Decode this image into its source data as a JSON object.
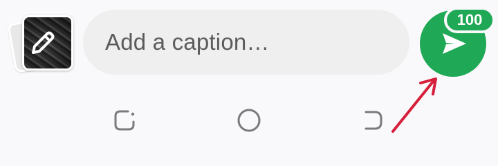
{
  "composer": {
    "caption_placeholder": "Add a caption…",
    "media_count_badge": "100"
  },
  "icons": {
    "edit": "pencil-icon",
    "send": "send-icon",
    "recents": "recent-apps-icon",
    "home": "home-icon",
    "back": "back-icon"
  },
  "colors": {
    "accent": "#1fa855",
    "annotation": "#d61f3a",
    "field_background": "#efefef",
    "placeholder_text": "#5b5b5b"
  }
}
